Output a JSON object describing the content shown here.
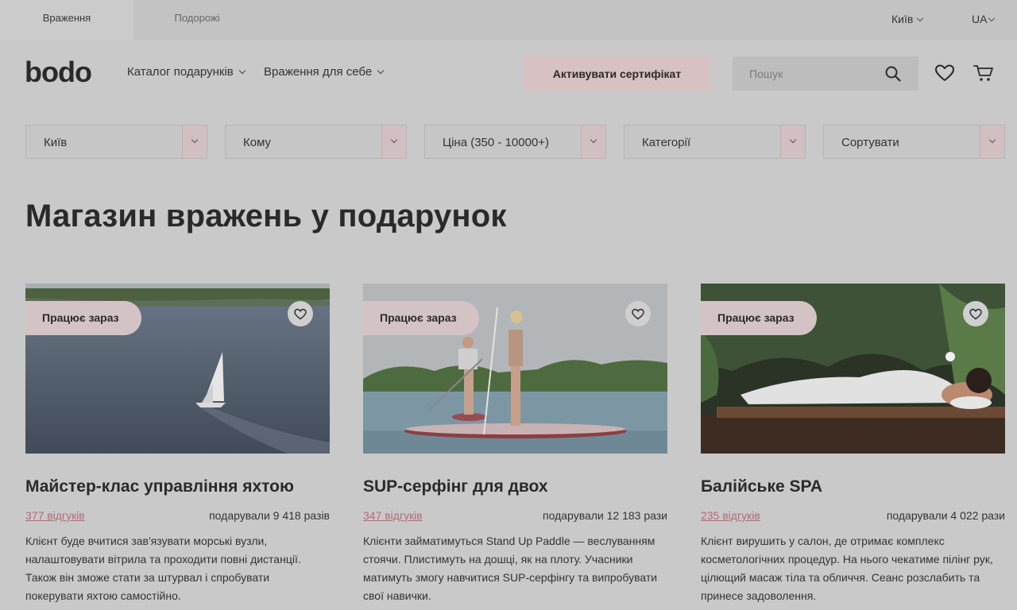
{
  "topbar": {
    "tabs": [
      {
        "label": "Враження",
        "active": true
      },
      {
        "label": "Подорожі",
        "active": false
      }
    ],
    "city": "Київ",
    "language": "UA"
  },
  "header": {
    "logo": "bodo",
    "nav": [
      {
        "label": "Каталог подарунків"
      },
      {
        "label": "Враження для себе"
      }
    ],
    "cta_label": "Активувати сертифікат",
    "search_placeholder": "Пошук",
    "icons": [
      "search-icon",
      "heart-icon",
      "cart-icon"
    ]
  },
  "filters": [
    {
      "label": "Київ"
    },
    {
      "label": "Кому"
    },
    {
      "label": "Ціна (350 - 10000+)"
    },
    {
      "label": "Категорії"
    },
    {
      "label": "Сортувати"
    }
  ],
  "page_title": "Магазин вражень у подарунок",
  "cards": [
    {
      "badge": "Працює зараз",
      "title": "Майстер-клас управління яхтою",
      "reviews": "377 відгуків",
      "gifted": "подарували 9 418 разів",
      "description": "Клієнт буде вчитися зав'язувати морські вузли, налаштовувати вітрила та проходити повні дистанції. Також він зможе стати за штурвал і спробувати покерувати яхтою самостійно."
    },
    {
      "badge": "Працює зараз",
      "title": "SUP-серфінг для двох",
      "reviews": "347 відгуків",
      "gifted": "подарували 12 183 рази",
      "description": "Клієнти займатимуться Stand Up Paddle — веслуванням стоячи. Плистимуть на дошці, як на плоту. Учасники матимуть змогу навчитися SUP-серфінгу та випробувати свої навички."
    },
    {
      "badge": "Працює зараз",
      "title": "Балійське SPA",
      "reviews": "235 відгуків",
      "gifted": "подарували 4 022 рази",
      "description": "Клієнт вирушить у салон, де отримає комплекс косметологічних процедур. На нього чекатиме пілінг рук, цілющий масаж тіла та обличчя. Сеанс розслабить та принесе задоволення."
    }
  ],
  "colors": {
    "accent": "#d7c1c3",
    "link": "#b36a74",
    "overlay_bg": "#c9c9c9"
  }
}
